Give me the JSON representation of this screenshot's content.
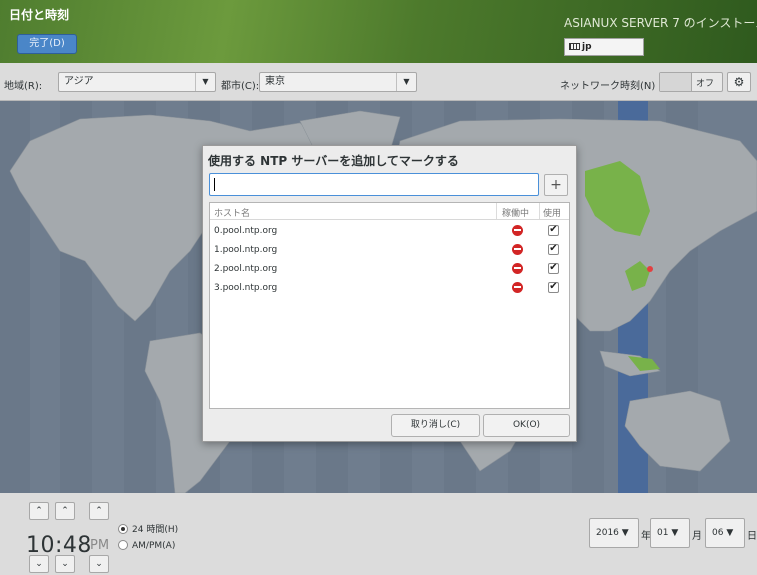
{
  "header": {
    "title": "日付と時刻",
    "done_label": "完了(D)",
    "product": "ASIANUX SERVER 7 のインストール",
    "keyboard_layout": "jp",
    "bg_color": "#5a8a34"
  },
  "toolbar": {
    "region_label": "地域(R):",
    "region_value": "アジア",
    "city_label": "都市(C):",
    "city_value": "東京",
    "network_time_label": "ネットワーク時刻(N)",
    "network_time_state": "オフ",
    "config_icon": "gear-icon"
  },
  "dialog": {
    "title": "使用する NTP サーバーを追加してマークする",
    "entry_value": "",
    "add_label": "+",
    "columns": {
      "host": "ホスト名",
      "working": "稼働中",
      "use": "使用"
    },
    "rows": [
      {
        "host": "0.pool.ntp.org",
        "working": "stop",
        "use": "✔"
      },
      {
        "host": "1.pool.ntp.org",
        "working": "stop",
        "use": "✔"
      },
      {
        "host": "2.pool.ntp.org",
        "working": "stop",
        "use": "✔"
      },
      {
        "host": "3.pool.ntp.org",
        "working": "stop",
        "use": "✔"
      }
    ],
    "cancel_label": "取り消し(C)",
    "ok_label": "OK(O)",
    "status_color": "#d22525"
  },
  "time": {
    "up_arrow": "⌃",
    "down_arrow": "⌄",
    "value": "10:48",
    "ampm": "PM",
    "format_24": "24 時間(H)",
    "format_ampm": "AM/PM(A)",
    "selected_format": "24h"
  },
  "date": {
    "year": "2016",
    "year_unit": "年",
    "month": "01",
    "month_unit": "月",
    "day": "06",
    "day_unit": "日",
    "dropdown_arrow": "▼"
  }
}
